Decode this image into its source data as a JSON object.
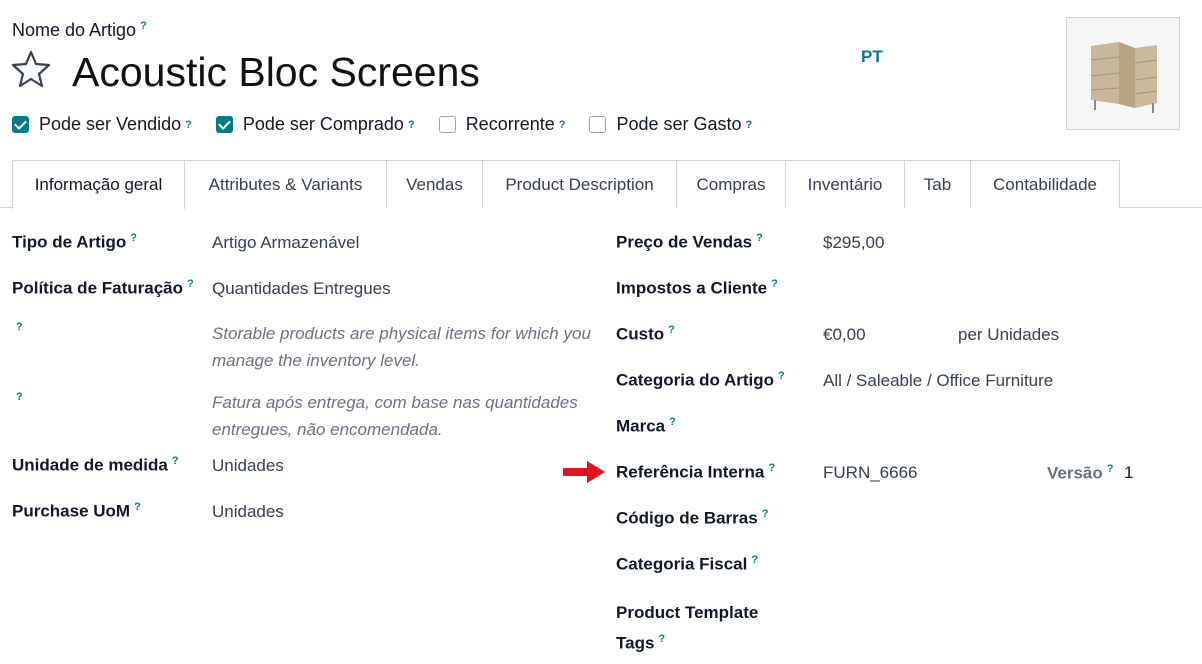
{
  "header": {
    "name_label": "Nome do Artigo",
    "help_mark": "?",
    "product_name": "Acoustic Bloc Screens",
    "language": "PT",
    "favorite_icon": "star-icon",
    "image_alt": "product-image"
  },
  "checkboxes": [
    {
      "label": "Pode ser Vendido",
      "checked": true
    },
    {
      "label": "Pode ser Comprado",
      "checked": true
    },
    {
      "label": "Recorrente",
      "checked": false
    },
    {
      "label": "Pode ser Gasto",
      "checked": false
    }
  ],
  "tabs": [
    {
      "label": "Informação geral",
      "active": true
    },
    {
      "label": "Attributes & Variants",
      "active": false
    },
    {
      "label": "Vendas",
      "active": false
    },
    {
      "label": "Product Description",
      "active": false
    },
    {
      "label": "Compras",
      "active": false
    },
    {
      "label": "Inventário",
      "active": false
    },
    {
      "label": "Tab",
      "active": false
    },
    {
      "label": "Contabilidade",
      "active": false
    }
  ],
  "left_fields": {
    "product_type_label": "Tipo de Artigo",
    "product_type_value": "Artigo Armazenável",
    "invoice_policy_label": "Política de Faturação",
    "invoice_policy_value": "Quantidades Entregues",
    "storable_help": "Storable products are physical items for which you manage the inventory level.",
    "invoice_help": "Fatura após entrega, com base nas quantidades entregues, não encomendada.",
    "uom_label": "Unidade de medida",
    "uom_value": "Unidades",
    "purchase_uom_label": "Purchase UoM",
    "purchase_uom_value": "Unidades"
  },
  "right_fields": {
    "sales_price_label": "Preço de Vendas",
    "sales_price_value": "$295,00",
    "customer_taxes_label": "Impostos a Cliente",
    "cost_label": "Custo",
    "cost_value": "€0,00",
    "cost_unit": "per Unidades",
    "category_label": "Categoria do Artigo",
    "category_value": "All / Saleable / Office Furniture",
    "brand_label": "Marca",
    "internal_ref_label": "Referência Interna",
    "internal_ref_value": "FURN_6666",
    "version_label": "Versão",
    "version_value": "1",
    "barcode_label": "Código de Barras",
    "fiscal_category_label": "Categoria Fiscal",
    "template_tags_label_1": "Product Template",
    "template_tags_label_2": "Tags"
  },
  "colors": {
    "accent": "#017e84",
    "arrow": "#e0141e"
  }
}
